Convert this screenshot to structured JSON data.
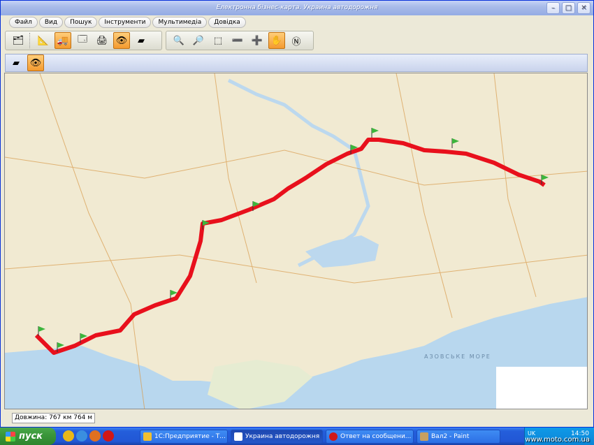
{
  "window": {
    "title": "Електронна бізнес-карта. Украина автодорожня"
  },
  "menu": [
    "Файл",
    "Вид",
    "Пошук",
    "Інструменти",
    "Мультимедіа",
    "Довідка"
  ],
  "map": {
    "route_color": "#e8101c",
    "sea_label": "АЗОВСЬКЕ МОРЕ"
  },
  "status": {
    "distance": "Довжина: 767 км 764 м"
  },
  "taskbar": {
    "start_label": "пуск",
    "tasks": [
      "1С:Предприятие - Т...",
      "Украина автодорожня",
      "Ответ на сообщени...",
      "Вал2 - Paint"
    ],
    "tray_lang": "UK",
    "clock": "14:50"
  },
  "watermark": "www.moto.com.ua"
}
